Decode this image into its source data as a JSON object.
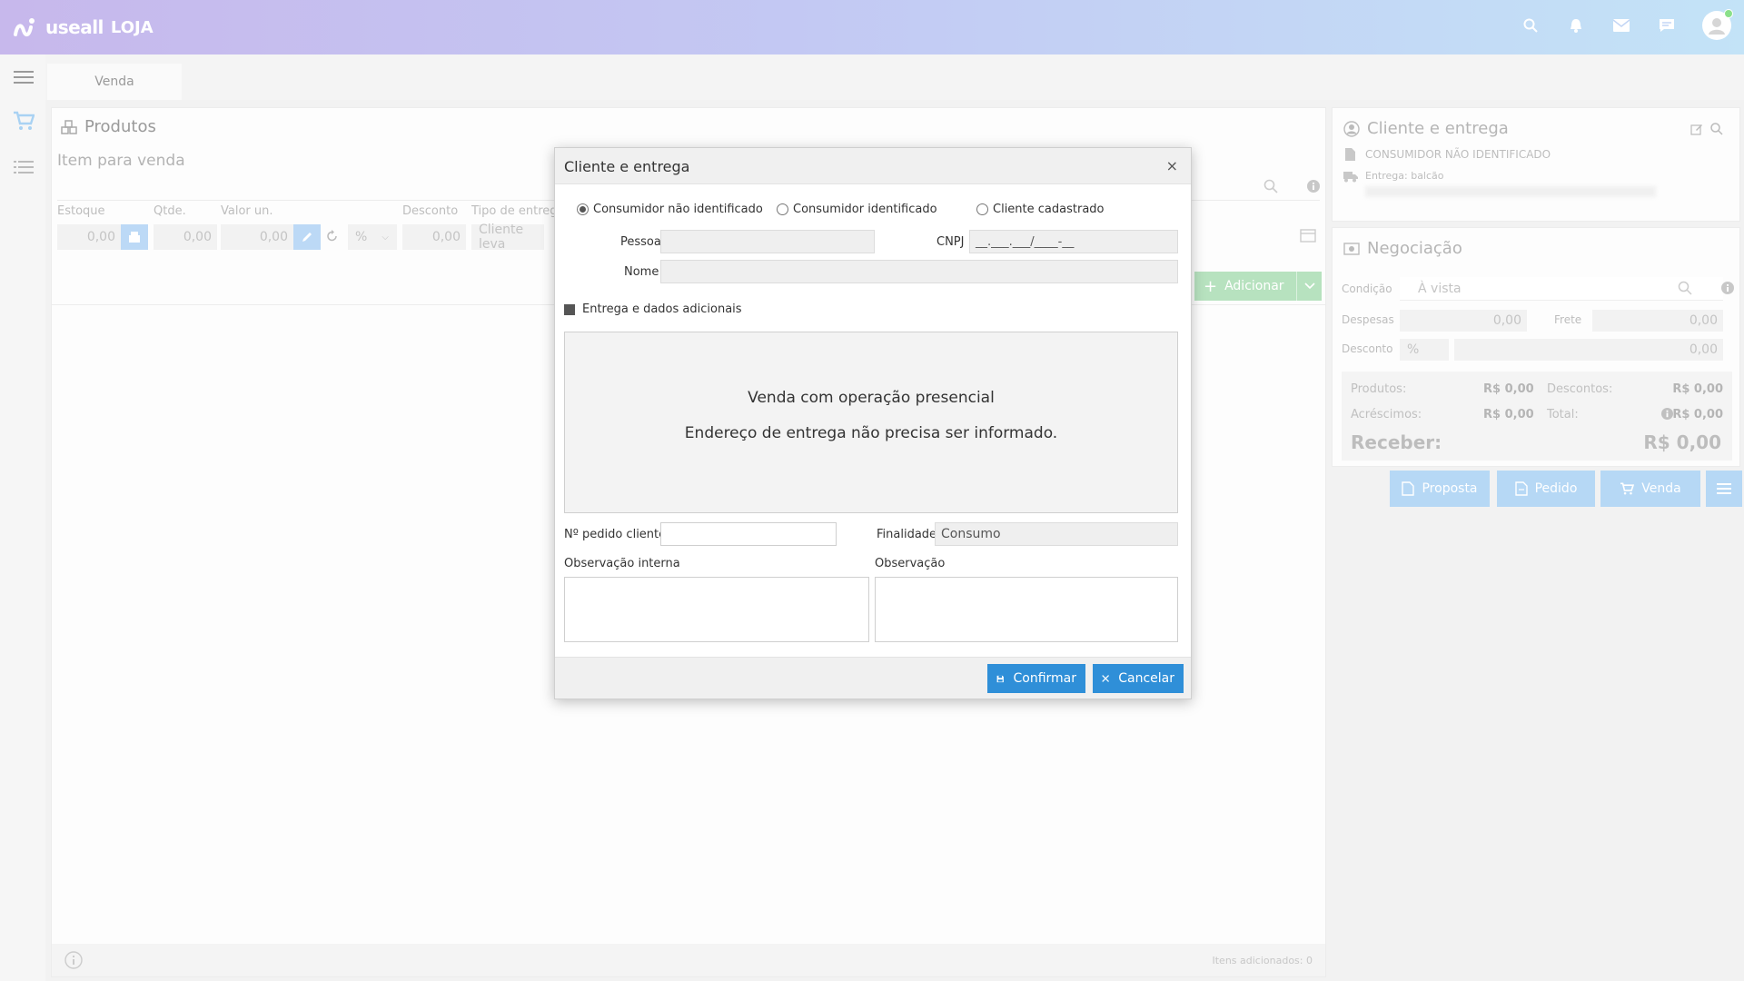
{
  "app": {
    "brand": "useall",
    "module": "LOJA"
  },
  "tabs": [
    {
      "label": "Venda"
    }
  ],
  "products": {
    "title": "Produtos",
    "item_label": "Item para venda",
    "fields": {
      "estoque": {
        "label": "Estoque",
        "value": "0,00"
      },
      "qtde": {
        "label": "Qtde.",
        "value": "0,00"
      },
      "valor_un": {
        "label": "Valor un.",
        "value": "0,00"
      },
      "desconto": {
        "label": "Desconto",
        "unit": "%",
        "value": "0,00"
      },
      "tipo_entrega": {
        "label": "Tipo de entrega",
        "value": "Cliente leva"
      }
    },
    "add_button": "Adicionar",
    "footer_count": "Itens adicionados: 0"
  },
  "client_panel": {
    "title": "Cliente e entrega",
    "customer": "CONSUMIDOR NÃO IDENTIFICADO",
    "delivery": "Entrega: balcão"
  },
  "negotiation": {
    "title": "Negociação",
    "condicao_label": "Condição",
    "condicao_value": "À vista",
    "despesas_label": "Despesas",
    "despesas_value": "0,00",
    "frete_label": "Frete",
    "frete_value": "0,00",
    "desconto_label": "Desconto",
    "desconto_unit": "%",
    "desconto_value": "0,00",
    "totals": {
      "produtos_label": "Produtos:",
      "produtos_value": "R$ 0,00",
      "descontos_label": "Descontos:",
      "descontos_value": "R$ 0,00",
      "acrescimos_label": "Acréscimos:",
      "acrescimos_value": "R$ 0,00",
      "total_label": "Total:",
      "total_value": "R$ 0,00",
      "receber_label": "Receber:",
      "receber_value": "R$ 0,00"
    }
  },
  "actions": {
    "proposta": "Proposta",
    "pedido": "Pedido",
    "venda": "Venda"
  },
  "modal": {
    "title": "Cliente e entrega",
    "close": "×",
    "radios": [
      {
        "label": "Consumidor não identificado",
        "checked": true
      },
      {
        "label": "Consumidor identificado",
        "checked": false
      },
      {
        "label": "Cliente cadastrado",
        "checked": false
      }
    ],
    "pessoa_label": "Pessoa",
    "cnpj_label": "CNPJ",
    "cnpj_mask": "__.___.___/____-__",
    "nome_label": "Nome",
    "entrega_check_label": "Entrega e dados adicionais",
    "delivery_line1": "Venda com operação presencial",
    "delivery_line2": "Endereço de entrega não precisa ser informado.",
    "pedido_label": "Nº pedido cliente",
    "finalidade_label": "Finalidade",
    "finalidade_value": "Consumo",
    "obs_interna_label": "Observação interna",
    "obs_label": "Observação",
    "confirm": "Confirmar",
    "cancel": "Cancelar"
  }
}
